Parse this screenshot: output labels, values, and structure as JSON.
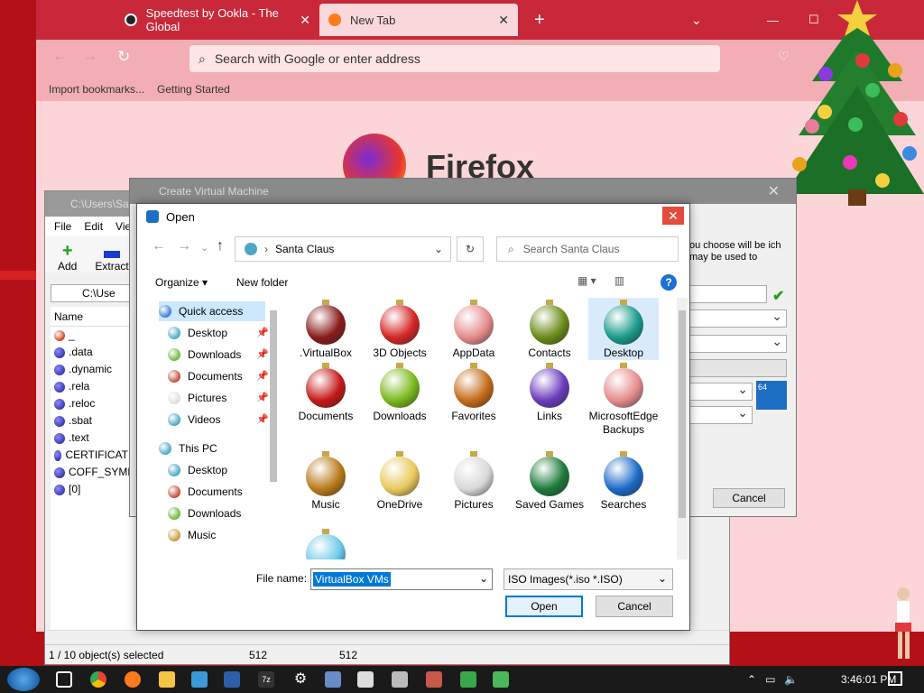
{
  "firefox": {
    "tabs": [
      {
        "label": "Speedtest by Ookla - The Global",
        "active": false
      },
      {
        "label": "New Tab",
        "active": true
      }
    ],
    "url_placeholder": "Search with Google or enter address",
    "bookmarks": [
      "Import bookmarks...",
      "Getting Started"
    ],
    "logo_text": "Firefox"
  },
  "zip_window": {
    "title": "C:\\Users\\Sa",
    "menu": [
      "File",
      "Edit",
      "Vie"
    ],
    "tools": [
      {
        "label": "Add",
        "icon": "plus-icon"
      },
      {
        "label": "Extract",
        "icon": "minus-icon"
      }
    ],
    "path": "C:\\Use",
    "column_header": "Name",
    "items": [
      "_",
      ".data",
      ".dynamic",
      ".rela",
      ".reloc",
      ".sbat",
      ".text",
      "CERTIFICATE",
      "COFF_SYMB",
      "[0]"
    ],
    "status": {
      "selected": "1 / 10 object(s) selected",
      "size1": "512",
      "size2": "512"
    }
  },
  "cvm_window": {
    "title": "Create Virtual Machine",
    "description": "ou choose will be ich may be used to",
    "cancel_label": "Cancel",
    "badge": "64"
  },
  "open_dialog": {
    "title": "Open",
    "breadcrumb": "Santa Claus",
    "search_placeholder": "Search Santa Claus",
    "organize_label": "Organize",
    "new_folder_label": "New folder",
    "help_label": "?",
    "nav_items": [
      {
        "label": "Quick access",
        "group": true,
        "selected": true
      },
      {
        "label": "Desktop",
        "pinned": true
      },
      {
        "label": "Downloads",
        "pinned": true
      },
      {
        "label": "Documents",
        "pinned": true
      },
      {
        "label": "Pictures",
        "pinned": true
      },
      {
        "label": "Videos",
        "pinned": true
      },
      {
        "label": "This PC",
        "group": true
      },
      {
        "label": "Desktop"
      },
      {
        "label": "Documents"
      },
      {
        "label": "Downloads"
      },
      {
        "label": "Music"
      }
    ],
    "files": [
      {
        "label": ".VirtualBox",
        "color": "#8a1b1b"
      },
      {
        "label": "3D Objects",
        "color": "#d42525"
      },
      {
        "label": "AppData",
        "color": "#e58b8b"
      },
      {
        "label": "Contacts",
        "color": "#6a8b18"
      },
      {
        "label": "Desktop",
        "color": "#1a9a8a",
        "selected": true
      },
      {
        "label": "Documents",
        "color": "#c41818"
      },
      {
        "label": "Downloads",
        "color": "#7ab81c"
      },
      {
        "label": "Favorites",
        "color": "#c46a18"
      },
      {
        "label": "Links",
        "color": "#6a3bbd"
      },
      {
        "label": "MicrosoftEdgeBackups",
        "color": "#e58b8b"
      },
      {
        "label": "Music",
        "color": "#b87a18"
      },
      {
        "label": "OneDrive",
        "color": "#e8c95c"
      },
      {
        "label": "Pictures",
        "color": "#d8d8d8"
      },
      {
        "label": "Saved Games",
        "color": "#1c7a3a"
      },
      {
        "label": "Searches",
        "color": "#1c6ac8"
      },
      {
        "label": "",
        "color": "#6ac8e8"
      }
    ],
    "file_name_label": "File name:",
    "file_name_value": "VirtualBox VMs",
    "file_type": "ISO Images(*.iso *.ISO)",
    "open_label": "Open",
    "cancel_label": "Cancel"
  },
  "taskbar": {
    "clock": "3:46:01 PM",
    "icons": [
      "start-icon",
      "task-view-icon",
      "chrome-icon",
      "firefox-icon",
      "explorer-icon",
      "virtualbox-app-icon",
      "virtualbox-icon",
      "7zip-icon",
      "settings-icon",
      "app-icon",
      "app-icon",
      "app-icon",
      "app-icon",
      "app-icon",
      "app-icon"
    ]
  }
}
